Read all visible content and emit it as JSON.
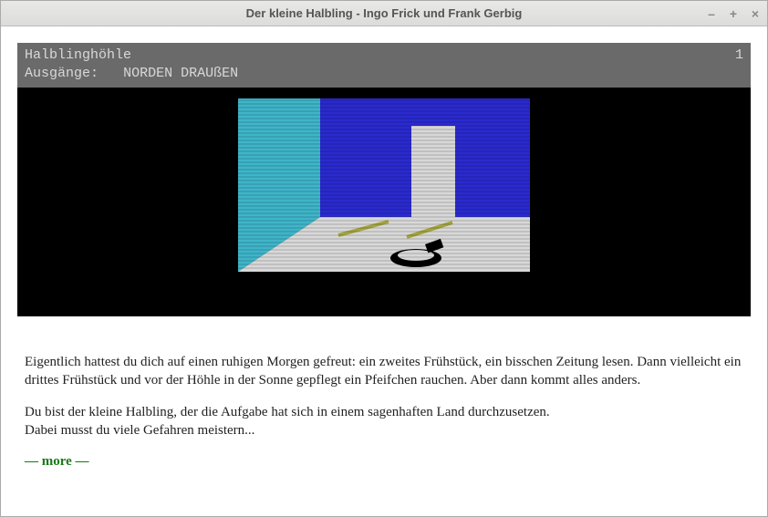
{
  "window": {
    "title": "Der kleine Halbling - Ingo Frick und Frank Gerbig"
  },
  "status": {
    "location": "Halblinghöhle",
    "moves": "1",
    "exits_label": "Ausgänge:",
    "exits": "NORDEN   DRAUßEN"
  },
  "story": {
    "p1": "Eigentlich hattest du dich auf einen ruhigen Morgen gefreut: ein zweites Frühstück, ein bisschen Zeitung lesen. Dann vielleicht ein drittes Frühstück und vor der Höhle in der Sonne gepflegt ein Pfeifchen rauchen. Aber dann kommt alles anders.",
    "p2": "Du bist der kleine Halbling, der die Aufgabe hat sich in einem sagenhaften Land durchzusetzen.",
    "p3": "Dabei musst du viele Gefahren meistern..."
  },
  "prompt": {
    "more": "— more —"
  },
  "colors": {
    "wall_left": "#3fb5c9",
    "wall_back": "#2a2acf",
    "floor": "#d8d8d8",
    "door": "#d8d8d8",
    "stripe": "#a4a43e"
  }
}
